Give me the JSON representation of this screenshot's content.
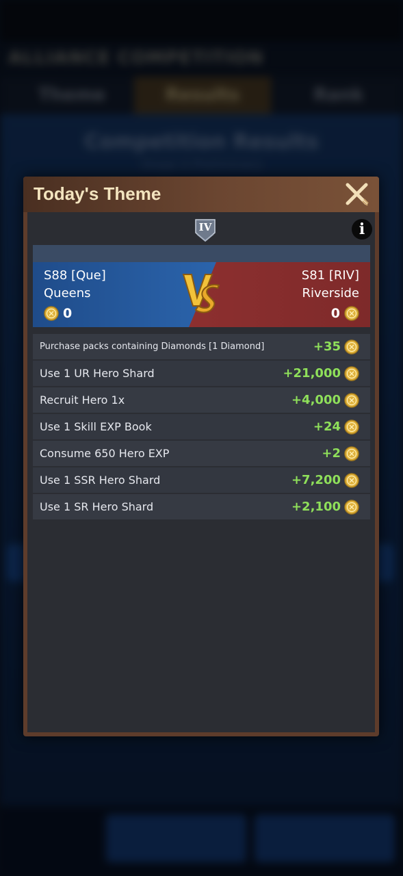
{
  "background": {
    "title": "ALLIANCE COMPETITION",
    "tabs": [
      "Theme",
      "Results",
      "Rank"
    ],
    "heading": "Competition Results",
    "subheading": "Stage 4 Preliminary"
  },
  "modal": {
    "title": "Today's Theme",
    "tier": "IV",
    "info_glyph": "i"
  },
  "teams": {
    "left": {
      "server": "S88 [Que]",
      "name": "Queens",
      "score": "0"
    },
    "right": {
      "server": "S81 [RIV]",
      "name": "Riverside",
      "score": "0"
    },
    "vs_icon": "vs-emblem-icon"
  },
  "tasks": [
    {
      "label": "Purchase packs containing Diamonds [1 Diamond]",
      "points": "+35"
    },
    {
      "label": "Use 1 UR Hero Shard",
      "points": "+21,000"
    },
    {
      "label": "Recruit Hero 1x",
      "points": "+4,000"
    },
    {
      "label": "Use 1 Skill EXP Book",
      "points": "+24"
    },
    {
      "label": "Consume 650 Hero EXP",
      "points": "+2"
    },
    {
      "label": "Use 1 SSR Hero Shard",
      "points": "+7,200"
    },
    {
      "label": "Use 1 SR Hero Shard",
      "points": "+2,100"
    }
  ],
  "colors": {
    "points_green": "#8fe05a",
    "team_left_blue": "#24589c",
    "team_right_red": "#8c2f2f",
    "title_cream": "#f3e4bf",
    "coin_gold": "#e0b23c"
  }
}
